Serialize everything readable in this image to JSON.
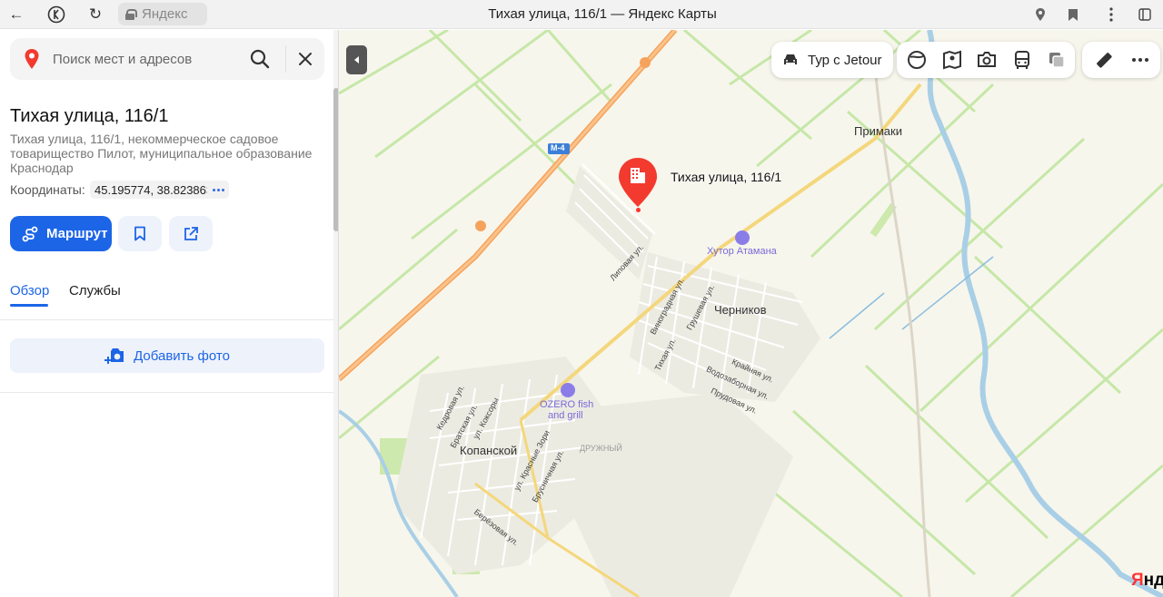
{
  "browser": {
    "url_text": "Яндекс",
    "page_title": "Тихая улица, 116/1 — Яндекс Карты",
    "back": "←",
    "reload": "↻"
  },
  "search": {
    "placeholder": "Поиск мест и адресов"
  },
  "place": {
    "title": "Тихая улица, 116/1",
    "address": "Тихая улица, 116/1, некоммерческое садовое товарищество Пилот, муниципальное образование Краснодар",
    "coords_label": "Координаты:",
    "coords_value": "45.195774, 38.823863"
  },
  "actions": {
    "route_label": "Маршрут"
  },
  "tabs": {
    "overview": "Обзор",
    "services": "Службы"
  },
  "add_photo_label": "Добавить фото",
  "map": {
    "ad_label": "Тур с Jetour",
    "pin_label": "Тихая улица, 116/1",
    "places": {
      "primaki": "Примаки",
      "chernikov": "Черников",
      "kopanskoy": "Копанской",
      "druzhny": "ДРУЖНЫЙ"
    },
    "pois": {
      "hutor": "Хутор Атамана",
      "ozero_1": "OZERO fish",
      "ozero_2": "and grill"
    },
    "road_label": "М-4",
    "streets": {
      "lipovaya": "Липовая ул.",
      "vinogradnaya": "Виноградная ул.",
      "grushevaya": "Грушевая ул.",
      "tikhaya": "Тихая ул.",
      "krainyaya": "Крайняя ул.",
      "vodozabornaya": "Водозаборная ул.",
      "prudovaya": "Прудовая ул.",
      "kedrovaya": "Кедровая ул.",
      "bratskaya": "Братская ул.",
      "koksory": "ул. Коксоры",
      "krasnye_zori": "ул. Красные Зори",
      "brusnichnaya": "Брусничная ул.",
      "berezovaya": "Берёзовая ул."
    },
    "logo": "Янд",
    "accent_color": "#1c65e7",
    "pin_color": "#f33a2f"
  }
}
